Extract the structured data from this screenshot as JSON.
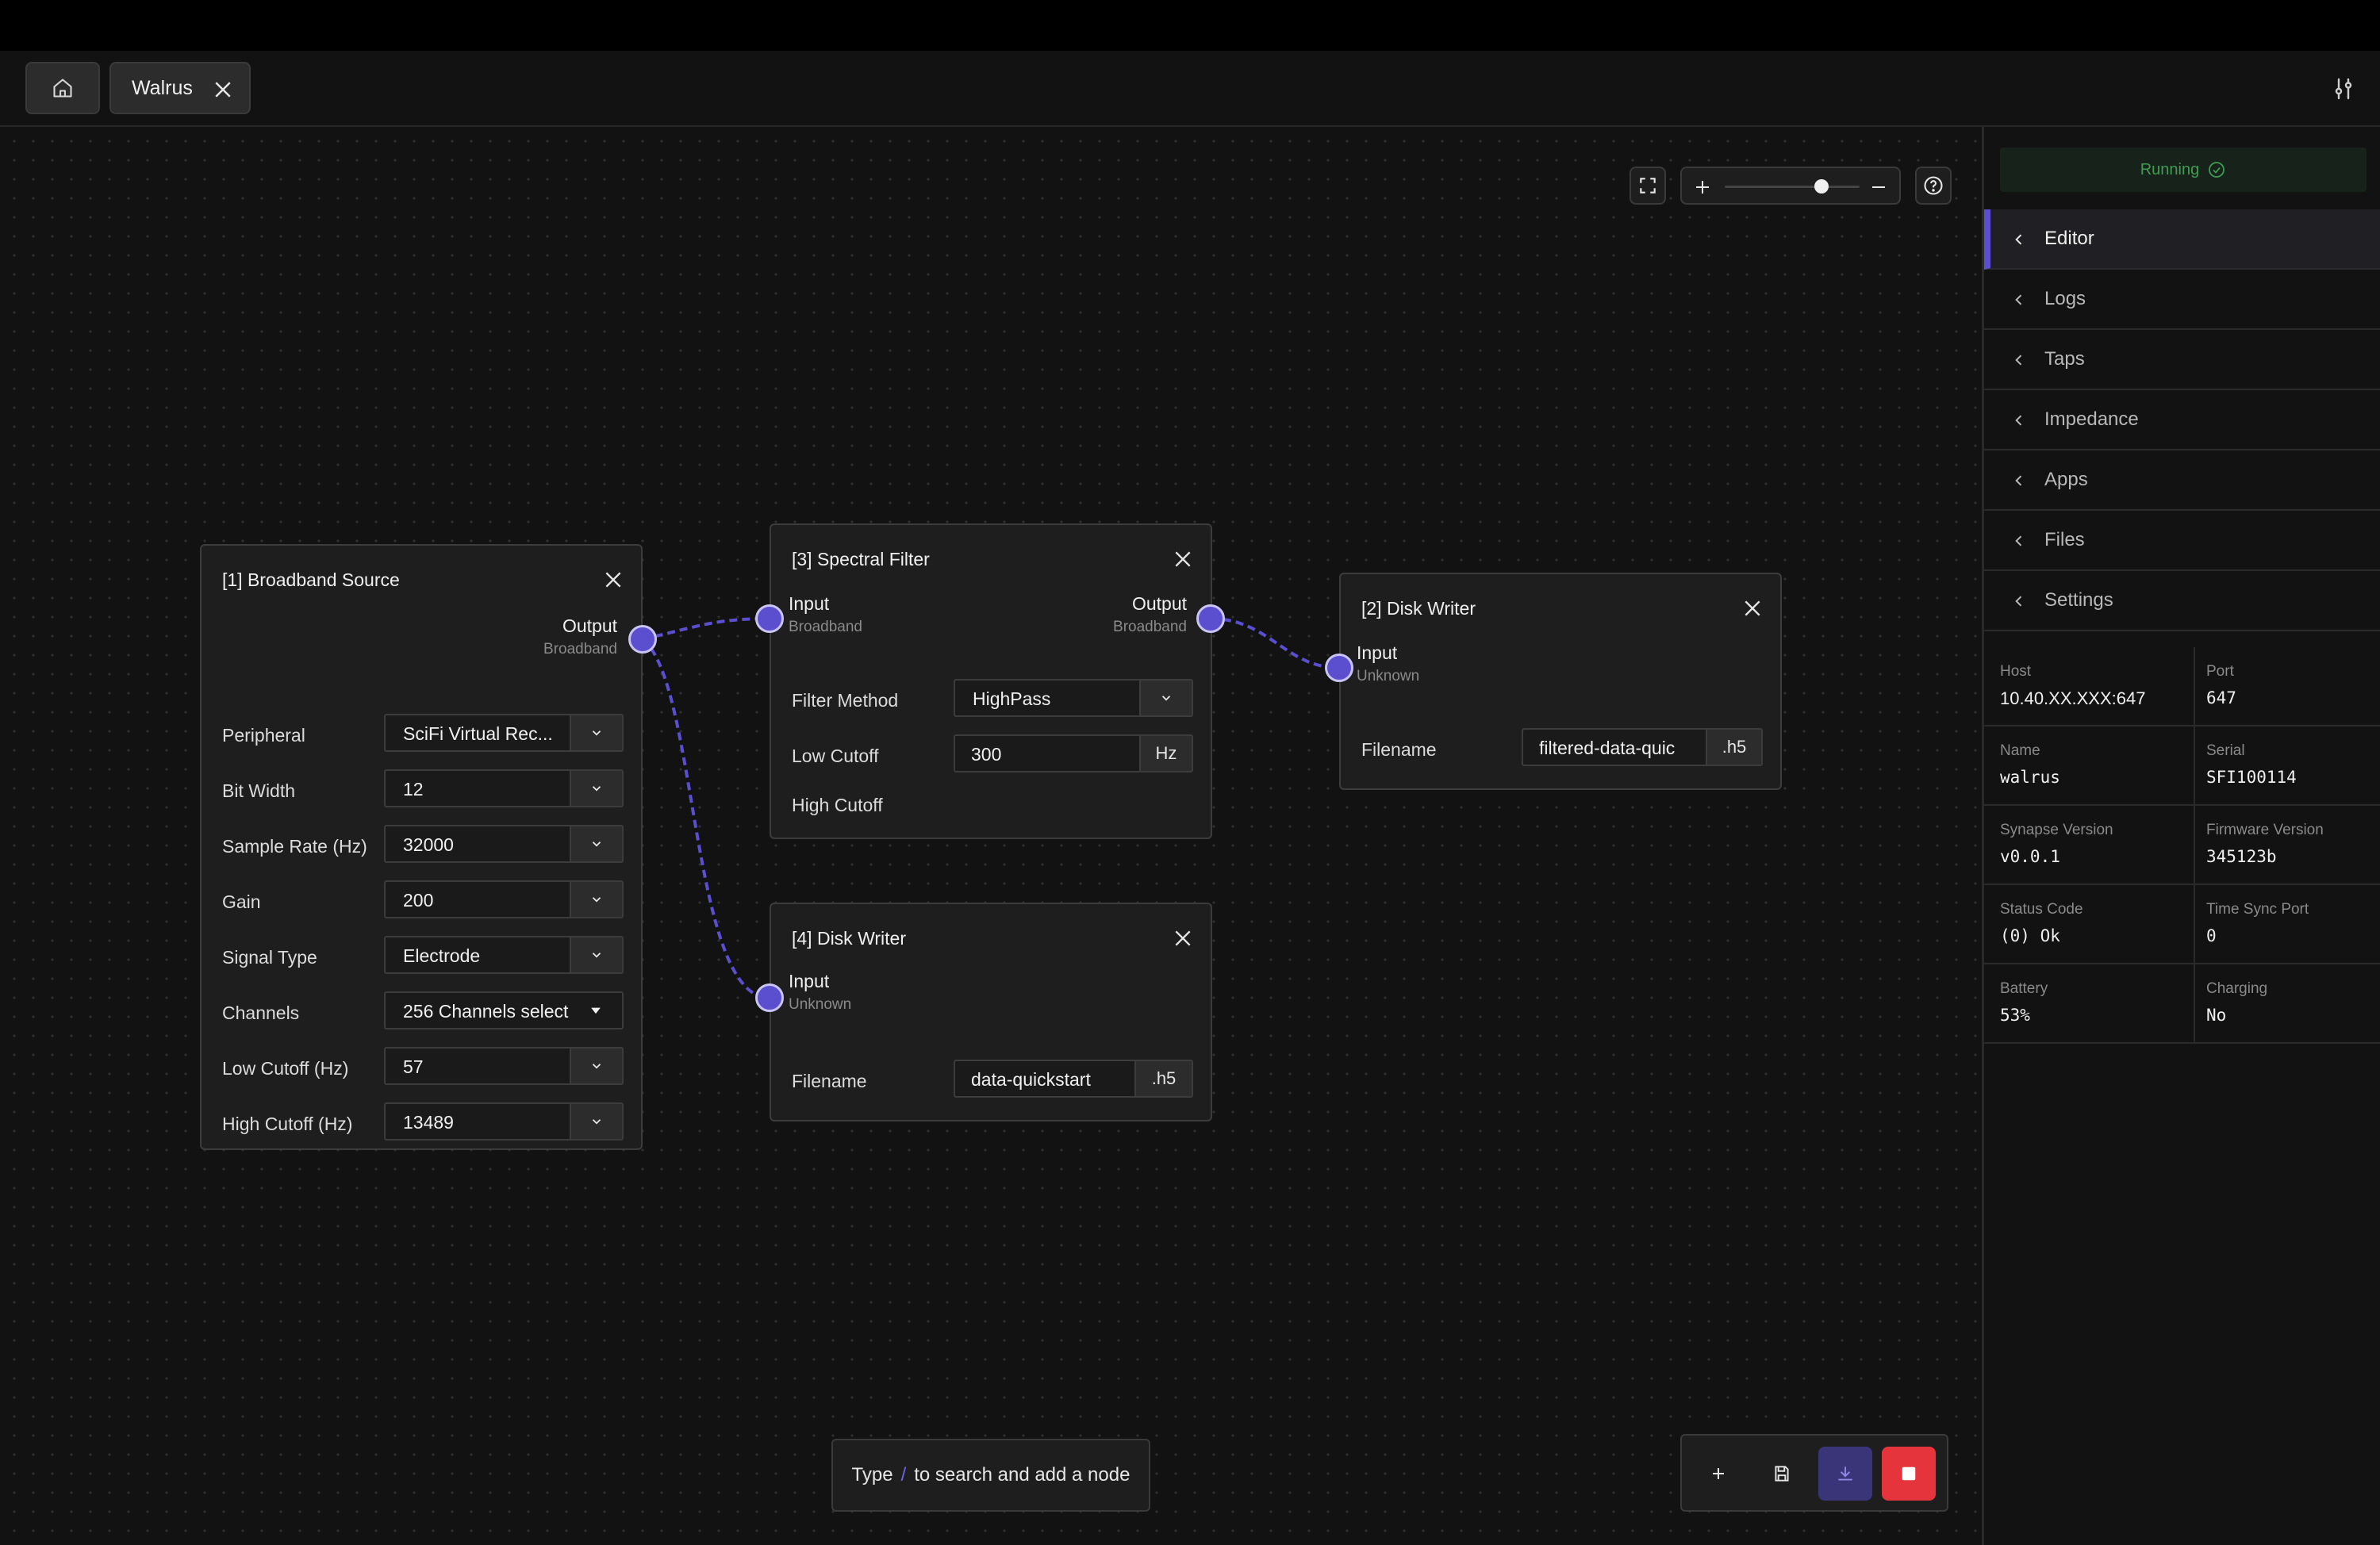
{
  "tabs": [
    {
      "label": "Walrus"
    }
  ],
  "colors": {
    "accent": "#5b4fd0",
    "running": "#3f9c52",
    "stop": "#e5343c",
    "download_bg": "#3a3478"
  },
  "canvas": {
    "zoom_fraction": 0.72,
    "search_hint": {
      "prefix": "Type",
      "key": "/",
      "suffix": "to search and add a node"
    },
    "nodes": {
      "broadband_source": {
        "title": "[1] Broadband Source",
        "output_label": "Output",
        "output_type": "Broadband",
        "fields": [
          {
            "label": "Peripheral",
            "value": "SciFi Virtual Rec..."
          },
          {
            "label": "Bit Width",
            "value": "12"
          },
          {
            "label": "Sample Rate (Hz)",
            "value": "32000"
          },
          {
            "label": "Gain",
            "value": "200"
          },
          {
            "label": "Signal Type",
            "value": "Electrode"
          },
          {
            "label": "Channels",
            "value": "256 Channels select..."
          },
          {
            "label": "Low Cutoff (Hz)",
            "value": "57"
          },
          {
            "label": "High Cutoff (Hz)",
            "value": "13489"
          }
        ]
      },
      "spectral_filter": {
        "title": "[3] Spectral Filter",
        "input_label": "Input",
        "input_type": "Broadband",
        "output_label": "Output",
        "output_type": "Broadband",
        "filter_method_label": "Filter Method",
        "filter_method_value": "HighPass",
        "low_cutoff_label": "Low Cutoff",
        "low_cutoff_value": "300",
        "low_cutoff_unit": "Hz",
        "high_cutoff_label": "High Cutoff"
      },
      "disk_writer_2": {
        "title": "[2] Disk Writer",
        "input_label": "Input",
        "input_type": "Unknown",
        "filename_label": "Filename",
        "filename_value": "filtered-data-quic",
        "extension": ".h5"
      },
      "disk_writer_4": {
        "title": "[4] Disk Writer",
        "input_label": "Input",
        "input_type": "Unknown",
        "filename_label": "Filename",
        "filename_value": "data-quickstart",
        "extension": ".h5"
      }
    }
  },
  "panel": {
    "status": "Running",
    "menu": [
      {
        "label": "Editor"
      },
      {
        "label": "Logs"
      },
      {
        "label": "Taps"
      },
      {
        "label": "Impedance"
      },
      {
        "label": "Apps"
      },
      {
        "label": "Files"
      },
      {
        "label": "Settings"
      }
    ],
    "info": [
      {
        "left": {
          "key": "Host",
          "value": "10.40.XX.XXX:647"
        },
        "right": {
          "key": "Port",
          "value": "647"
        }
      },
      {
        "left": {
          "key": "Name",
          "value": "walrus"
        },
        "right": {
          "key": "Serial",
          "value": "SFI100114"
        }
      },
      {
        "left": {
          "key": "Synapse Version",
          "value": "v0.0.1"
        },
        "right": {
          "key": "Firmware Version",
          "value": "345123b"
        }
      },
      {
        "left": {
          "key": "Status Code",
          "value": "(0) Ok"
        },
        "right": {
          "key": "Time Sync Port",
          "value": "0"
        }
      },
      {
        "left": {
          "key": "Battery",
          "value": "53%"
        },
        "right": {
          "key": "Charging",
          "value": "No"
        }
      }
    ]
  }
}
